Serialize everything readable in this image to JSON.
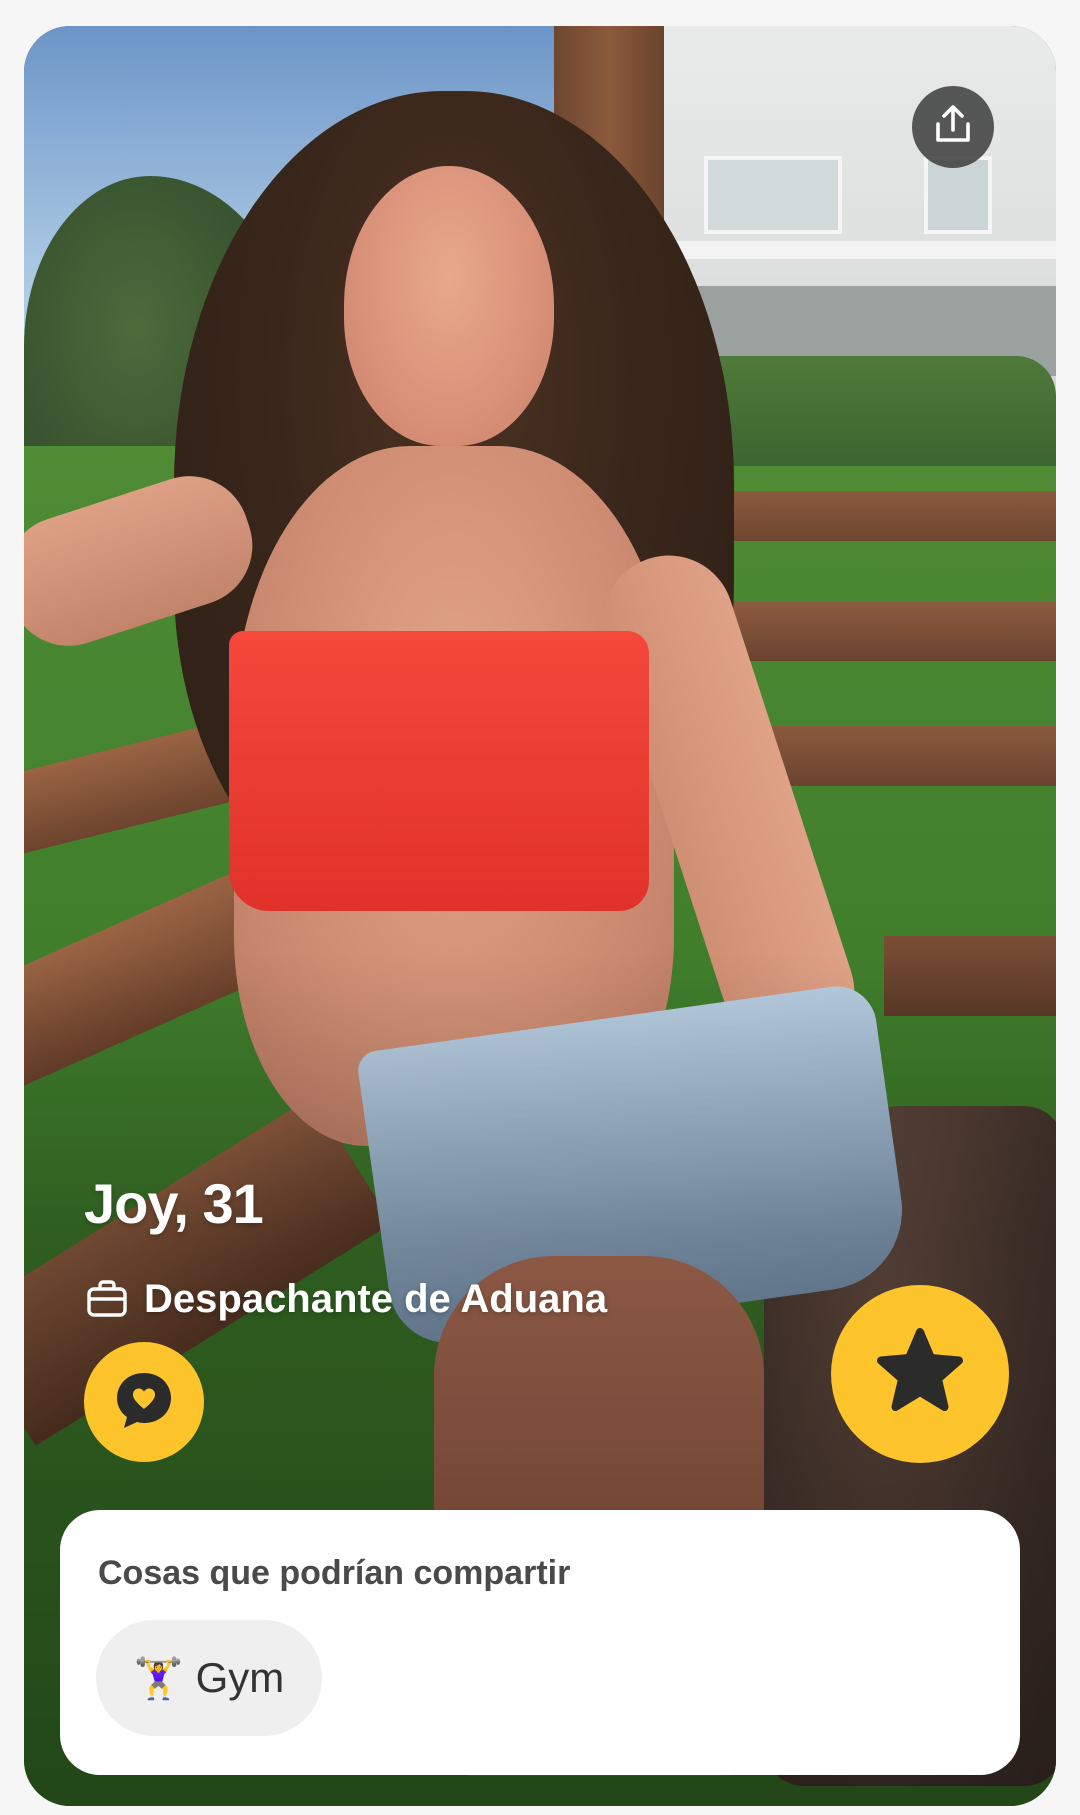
{
  "profile": {
    "name_age": "Joy, 31",
    "job": "Despachante de Aduana",
    "photo_alt": "Profile photo"
  },
  "shared": {
    "title": "Cosas que podrían compartir",
    "chips": [
      {
        "emoji": "🏋️‍♀️",
        "label": "Gym"
      }
    ]
  },
  "icons": {
    "share": "share-icon",
    "job": "briefcase-icon",
    "compliment": "compliment-heart-bubble-icon",
    "superswipe": "star-icon"
  },
  "colors": {
    "accent": "#fdc42c",
    "icon_dark": "#2b2b2b"
  }
}
